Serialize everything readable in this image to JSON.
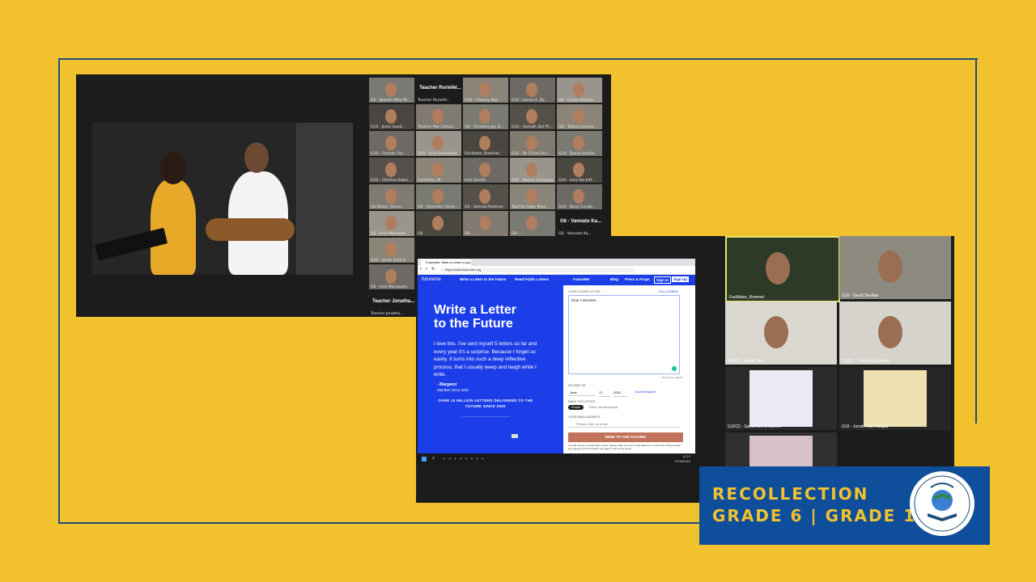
{
  "video_grid": {
    "tiles": [
      "G6 - Natalia Milla Mi...",
      "Teacher Roriefel...",
      "G10 - Cherrey Dat...",
      "G10 - Lenne A. Dy...",
      "G6 - Louise Gordon...",
      "G10 - Jesse Gaad...",
      "Teacher Mal Camps...",
      "G6 - Christine Joy D...",
      "G10 - Hannah Dal Ph...",
      "G6 - Tatana Llerena",
      "G10 - Cormac Fan...",
      "G10 - Ariel Fernandez",
      "Facilitator_Rommel",
      "G10 - Dr Chirra Sen...",
      "G10 - David Sevillas",
      "G10 - Chirsiva Aubin...",
      "Facilitator_M...",
      "Irish Sevilla",
      "G10 - Ronnie Zaragoza",
      "G10 - Lora Sat Jeff...",
      "Facilitator_Ronel...",
      "G6 - Sylvester Flores...",
      "G6 - Samuel Ramirez",
      "Teacher Seby Malo...",
      "G10 - Daryl Cumbl...",
      "G6 - Irish Maniquel...",
      "G6 - ...",
      "G6 - ...",
      "G6 - ...",
      "G6 - Vannato Ka...",
      "G10 - Jonah Faith A...",
      "G6 - Irish Maniquela",
      "Teacher Jonatha..."
    ],
    "label_teacher_1": "Teacher Roriefel...",
    "label_g6_vannato": "G6 - Vannato Ka...",
    "label_teacher_2": "Teacher Jonatha..."
  },
  "browser": {
    "tab_title": "FutureMe: Write a Letter to you...",
    "url": "https://www.futureme.org",
    "nav": {
      "logo": "futureme",
      "write_link": "Write a Letter to the Future",
      "read_link": "Read Public Letters",
      "brand_pill": "FutureMe",
      "blog": "Blog",
      "press": "Press & Props",
      "sign_in": "Sign In",
      "sign_up": "Sign Up"
    },
    "hero_title": "Write a Letter to the Future",
    "testimonial": "I love this. I've sent myself 5 letters so far and every year it's a surprise. Because I forget so easily. It turns into such a deep reflective process, that I usually weep and laugh while I write.",
    "author": "- Margaret",
    "author_sub": "Member since 2011",
    "stat": "OVER 10 MILLION LETTERS DELIVERED TO THE FUTURE SINCE 2002",
    "form": {
      "letter_label": "YOUR FUTURE LETTER",
      "fullscreen": "FULL SCREEN",
      "letter_value": "Dear FutureMe,",
      "need_help": "Need some ideas?",
      "deliver_label": "DELIVER ON",
      "month": "June",
      "day": "17",
      "year": "2032",
      "choose_random": "Choose Random",
      "make_label": "MAKE THIS LETTER",
      "private": "Private",
      "public": "Public, but anonymous",
      "email_label": "YOUR EMAIL ADDRESS",
      "email_placeholder": "Please enter an email",
      "send_button": "SEND TO THE FUTURE!",
      "fineprint": "You will receive a confirmation email - please make sure your email address is correct! By writing a letter and signing up for FutureMe you agree to the Terms of use."
    },
    "taskbar_time": "12:12",
    "taskbar_date": "17/06/2022"
  },
  "right_grid": {
    "tiles": [
      "Facilitator_Rommel",
      "G10 - David Sevillas",
      "G10C2 - Sarah Tan",
      "G10C2 - Yuna De Guzman",
      "G10C2 - Sarah Lee G Alberto",
      "G10 - Jonah Faith Abagat",
      "",
      "Teacher Roriefel..."
    ]
  },
  "banner": {
    "line1": "RECOLLECTION",
    "line2": "GRADE 6 | GRADE 10",
    "logo_text": "BETHUNO CHRISTIAN ACADEMY"
  },
  "colors": {
    "background": "#F1C22E",
    "banner": "#0F4E9B",
    "frame": "#1E4E7E",
    "futureme_blue": "#1B3EE8",
    "send_button": "#C0735A"
  }
}
